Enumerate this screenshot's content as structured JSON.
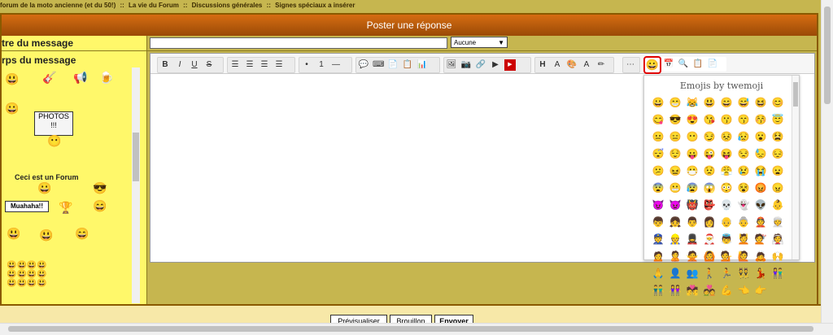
{
  "breadcrumb": {
    "items": [
      "forum de la moto ancienne (et du 50!)",
      "::",
      "La vie du Forum",
      "::",
      "Discussions générales",
      "::",
      "Signes spéciaux a insérer"
    ]
  },
  "panel": {
    "title": "Poster une réponse",
    "subject_label": "tre du message",
    "body_label": "rps du message",
    "select_value": "Aucune"
  },
  "left_smilies": {
    "photos_sign": "PHOTOS\n!!!",
    "ceci_text": "Ceci est un Forum",
    "muahaha_text": "Muahaha!!"
  },
  "toolbar": {
    "bold": "B",
    "italic": "I",
    "underline": "U",
    "strike": "S",
    "h_heading": "H"
  },
  "emoji_popup": {
    "title": "Emojis by twemoji",
    "emojis": [
      "😀",
      "😁",
      "😹",
      "😃",
      "😄",
      "😅",
      "😆",
      "😊",
      "😋",
      "😎",
      "😍",
      "😘",
      "😗",
      "😙",
      "😚",
      "😇",
      "😐",
      "😑",
      "😶",
      "😏",
      "😣",
      "😥",
      "😮",
      "😫",
      "😴",
      "😌",
      "😛",
      "😜",
      "😝",
      "😒",
      "😓",
      "😔",
      "😕",
      "😖",
      "😷",
      "😟",
      "😤",
      "😢",
      "😭",
      "😦",
      "😨",
      "😬",
      "😰",
      "😱",
      "😳",
      "😵",
      "😡",
      "😠",
      "😈",
      "👿",
      "👹",
      "👺",
      "💀",
      "👻",
      "👽",
      "👶",
      "👦",
      "👧",
      "👨",
      "👩",
      "👴",
      "👵",
      "👲",
      "👳",
      "👮",
      "👷",
      "💂",
      "🎅",
      "👼",
      "💆",
      "💇",
      "👰",
      "🙍",
      "🙎",
      "🙅",
      "🙆",
      "💁",
      "🙋",
      "🙇",
      "🙌",
      "🙏",
      "👤",
      "👥",
      "🚶",
      "🏃",
      "👯",
      "💃",
      "👫",
      "👬",
      "👭",
      "💏",
      "💑",
      "💪",
      "👈",
      "👉"
    ]
  },
  "buttons": {
    "preview": "Prévisualiser",
    "draft": "Brouillon",
    "send": "Envoyer"
  }
}
